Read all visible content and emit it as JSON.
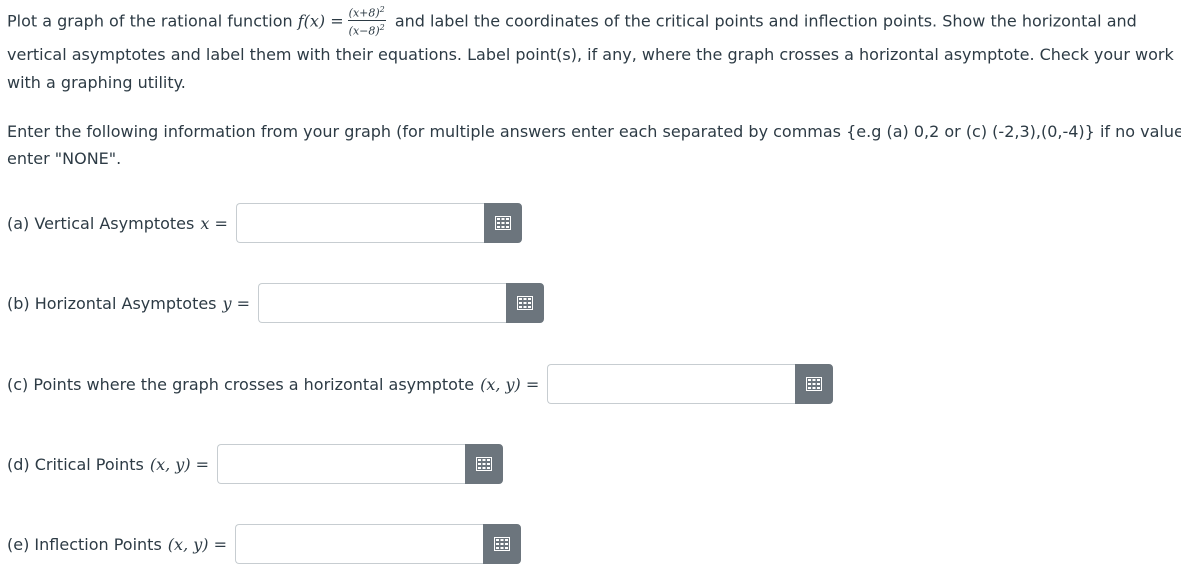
{
  "problem": {
    "line1_prefix": "Plot a graph of the rational function",
    "f_lhs": "f(x) =",
    "frac_num": "(x+8)",
    "frac_den": "(x−8)",
    "exponent": "2",
    "line1_suffix": "and label the coordinates of the critical points and inflection points. Show the horizontal and",
    "line2": "vertical asymptotes and label them with their equations. Label point(s), if any, where the graph crosses a horizontal asymptote. Check your work",
    "line3": "with a graphing utility."
  },
  "instructions": {
    "line1": "Enter the following information from your graph (for multiple answers enter each separated by commas {e.g (a) 0,2 or (c) (-2,3),(0,-4)} if no value",
    "line2": "enter \"NONE\"."
  },
  "questions": {
    "a": {
      "label": "(a) Vertical Asymptotes",
      "math": "x =",
      "value": ""
    },
    "b": {
      "label": "(b) Horizontal Asymptotes",
      "math": "y =",
      "value": ""
    },
    "c": {
      "label": "(c) Points where the graph crosses a horizontal asymptote",
      "math": "(x, y) =",
      "value": ""
    },
    "d": {
      "label": "(d) Critical Points",
      "math": "(x, y) =",
      "value": ""
    },
    "e": {
      "label": "(e) Inflection Points",
      "math": "(x, y) =",
      "value": ""
    }
  },
  "icons": {
    "answer_button": "grid-keypad-icon"
  },
  "colors": {
    "text": "#2d3b45",
    "button_bg": "#6c757d",
    "input_border": "#c7cdd1"
  }
}
